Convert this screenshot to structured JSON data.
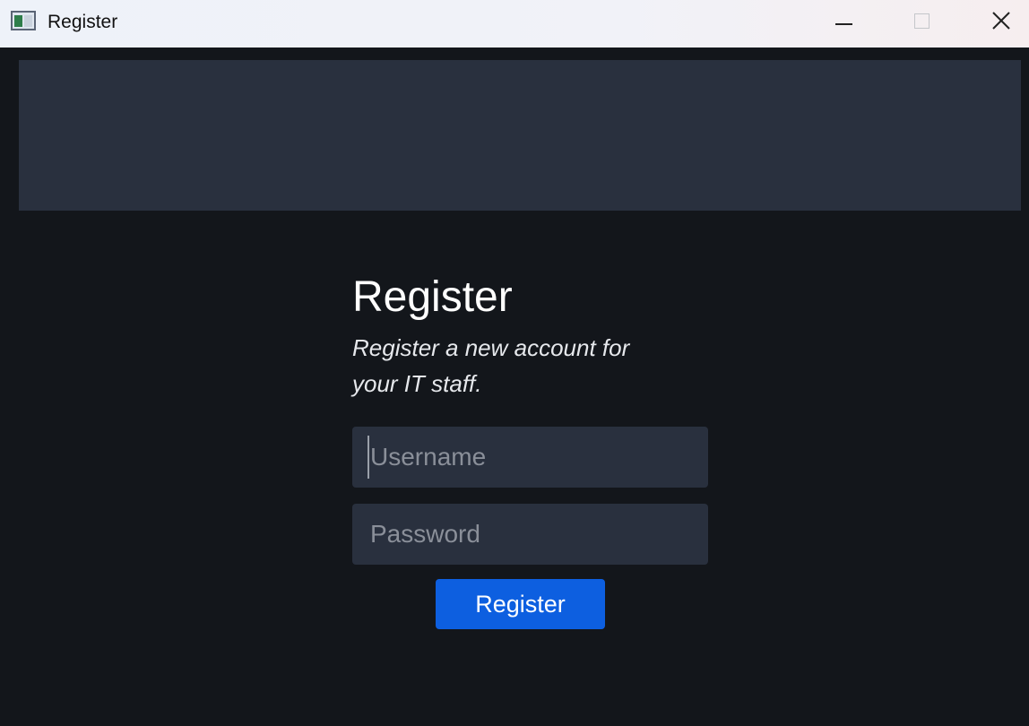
{
  "window": {
    "title": "Register"
  },
  "form": {
    "title": "Register",
    "subtitle": "Register a new account for your IT staff.",
    "username_placeholder": "Username",
    "password_placeholder": "Password",
    "submit_label": "Register"
  },
  "colors": {
    "background": "#13161b",
    "panel": "#29303e",
    "accent": "#0d5fe0"
  }
}
